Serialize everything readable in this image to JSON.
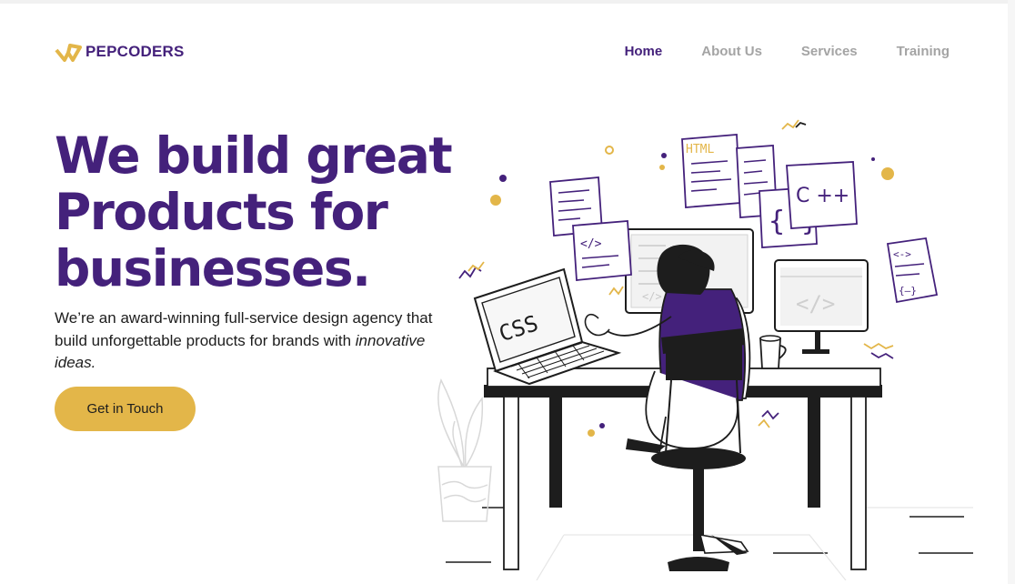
{
  "brand": {
    "name": "PEPCODERS",
    "accent": "#44217b",
    "gold": "#e3b649"
  },
  "nav": [
    {
      "label": "Home",
      "active": true
    },
    {
      "label": "About Us",
      "active": false
    },
    {
      "label": "Services",
      "active": false
    },
    {
      "label": "Training",
      "active": false
    }
  ],
  "hero": {
    "title_line1": "We build great",
    "title_line2": "Products for",
    "title_line3": "businesses.",
    "subtitle_main": "We’re an award-winning full-service design agency that build unforgettable products for brands with",
    "subtitle_italic": "innovative ideas.",
    "cta_label": "Get in Touch"
  },
  "illustration": {
    "laptop_text": "CSS",
    "doc_html_text": "HTML",
    "doc_cpp_text": "C ++",
    "code_tag_1": "</>",
    "code_tag_2": "</>",
    "brace_text": "{ }",
    "small_tag": "<->",
    "small_brace": "{—}"
  }
}
